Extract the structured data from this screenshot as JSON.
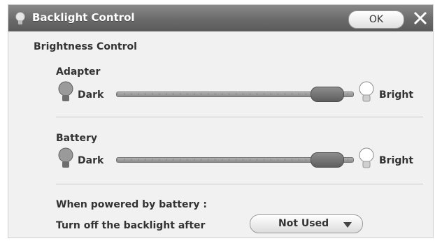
{
  "window": {
    "title": "Backlight Control",
    "ok_label": "OK",
    "close_icon": "close-icon",
    "title_icon": "lightbulb-icon"
  },
  "section_title": "Brightness Control",
  "adapter": {
    "label": "Adapter",
    "min_label": "Dark",
    "max_label": "Bright",
    "level": 0.92
  },
  "battery": {
    "label": "Battery",
    "min_label": "Dark",
    "max_label": "Bright",
    "level": 0.92
  },
  "power_note": "When powered by battery :",
  "backlight_off": {
    "label": "Turn off the backlight after",
    "selected": "Not Used"
  },
  "colors": {
    "titlebar": "#6a6a6a",
    "background": "#f1f1f1",
    "thumb": "#6e6e6e"
  }
}
